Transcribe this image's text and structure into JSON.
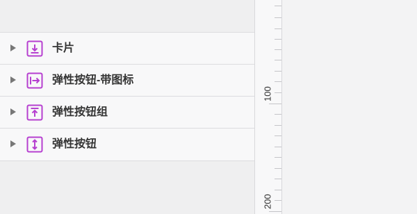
{
  "layers": {
    "items": [
      {
        "label": "卡片",
        "icon": "align-bottom-icon"
      },
      {
        "label": "弹性按钮-带图标",
        "icon": "align-right-icon"
      },
      {
        "label": "弹性按钮组",
        "icon": "align-top-icon"
      },
      {
        "label": "弹性按钮",
        "icon": "align-vertical-center-icon"
      }
    ]
  },
  "ruler": {
    "labels": [
      "100",
      "200"
    ]
  },
  "colors": {
    "icon_accent": "#b63fd0"
  }
}
